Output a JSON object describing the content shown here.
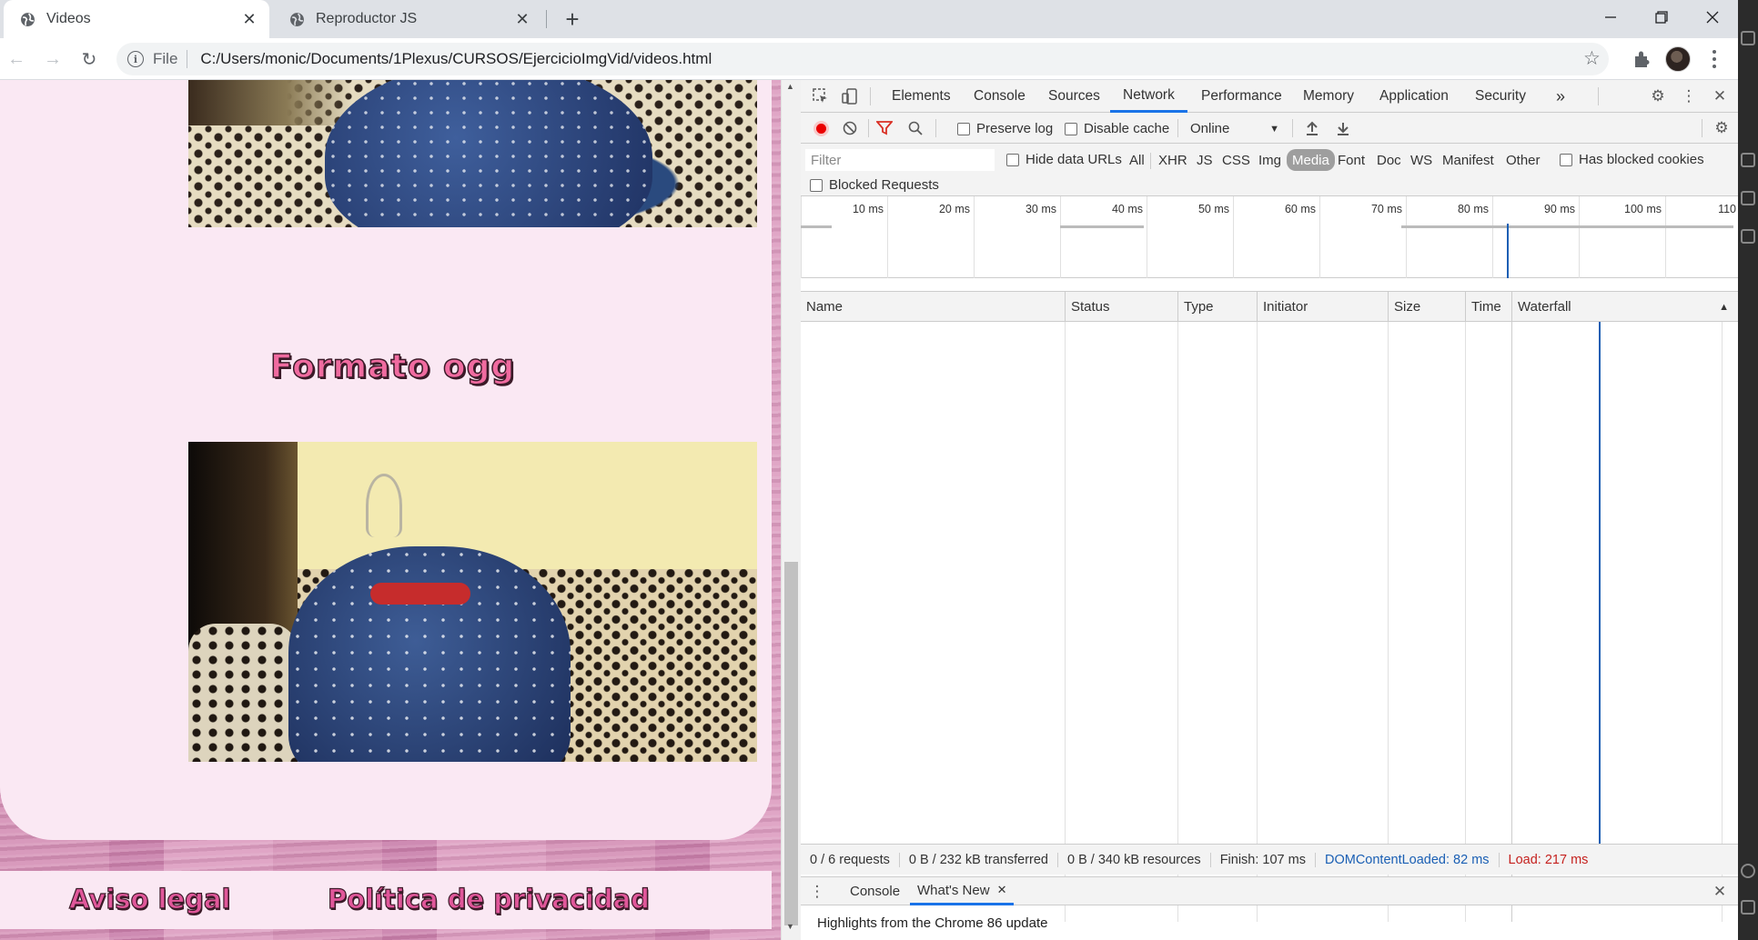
{
  "browser": {
    "tabs": [
      {
        "title": "Videos",
        "active": true
      },
      {
        "title": "Reproductor JS",
        "active": false
      }
    ],
    "address": {
      "scheme": "File",
      "url": "C:/Users/monic/Documents/1Plexus/CURSOS/EjercicioImgVid/videos.html"
    }
  },
  "page": {
    "section_title": "Formato ogg",
    "footer": {
      "legal": "Aviso legal",
      "privacy": "Política de privacidad"
    },
    "colors": {
      "card": "#fae8f3",
      "title": "#f06ba0",
      "footer_link": "#e0579a"
    }
  },
  "devtools": {
    "tabs": [
      "Elements",
      "Console",
      "Sources",
      "Network",
      "Performance",
      "Memory",
      "Application",
      "Security"
    ],
    "active_tab": "Network",
    "more_tabs": "»",
    "toolbar": {
      "preserve_log": "Preserve log",
      "disable_cache": "Disable cache",
      "throttle": "Online"
    },
    "filter": {
      "placeholder": "Filter",
      "hide_data_urls": "Hide data URLs",
      "types": [
        "All",
        "XHR",
        "JS",
        "CSS",
        "Img",
        "Media",
        "Font",
        "Doc",
        "WS",
        "Manifest",
        "Other"
      ],
      "active_type": "Media",
      "has_blocked_cookies": "Has blocked cookies",
      "blocked_requests": "Blocked Requests"
    },
    "timeline_ticks": [
      "10 ms",
      "20 ms",
      "30 ms",
      "40 ms",
      "50 ms",
      "60 ms",
      "70 ms",
      "80 ms",
      "90 ms",
      "100 ms",
      "110"
    ],
    "columns": [
      "Name",
      "Status",
      "Type",
      "Initiator",
      "Size",
      "Time",
      "Waterfall"
    ],
    "status": {
      "requests": "0 / 6 requests",
      "transferred": "0 B / 232 kB transferred",
      "resources": "0 B / 340 kB resources",
      "finish": "Finish: 107 ms",
      "dom_content_loaded": "DOMContentLoaded: 82 ms",
      "load": "Load: 217 ms"
    },
    "drawer": {
      "tabs": [
        "Console",
        "What's New"
      ],
      "active": "What's New",
      "content": "Highlights from the Chrome 86 update"
    },
    "colors": {
      "accent": "#1a73e8",
      "record": "#ea0000",
      "dcl": "#1a5fb4",
      "load": "#c5221f"
    }
  }
}
